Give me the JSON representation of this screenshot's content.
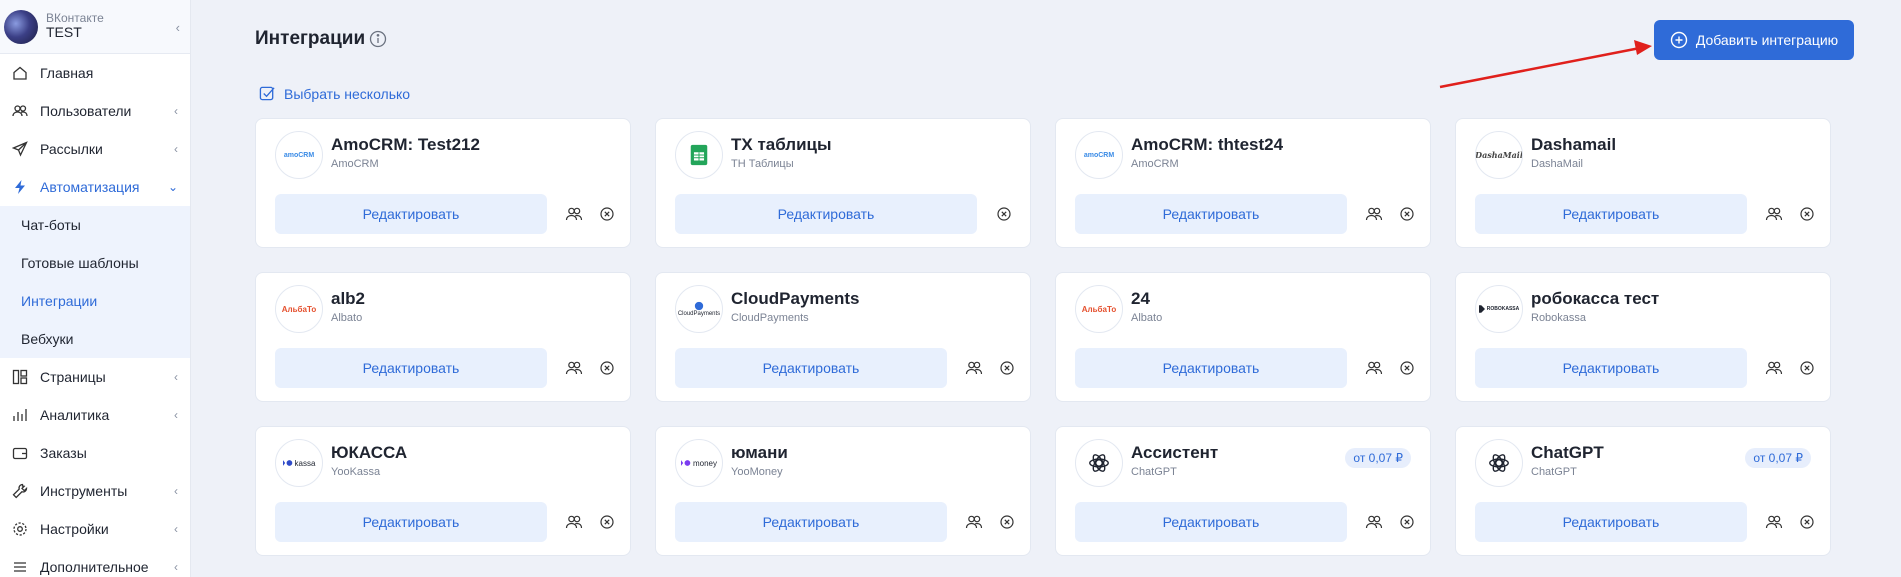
{
  "account": {
    "sub": "ВКонтакте",
    "name": "TEST"
  },
  "nav": {
    "home": "Главная",
    "users": "Пользователи",
    "mailings": "Рассылки",
    "automation": "Автоматизация",
    "sub": {
      "chatbots": "Чат-боты",
      "templates": "Готовые шаблоны",
      "integrations": "Интеграции",
      "webhooks": "Вебхуки"
    },
    "pages": "Страницы",
    "analytics": "Аналитика",
    "orders": "Заказы",
    "tools": "Инструменты",
    "settings": "Настройки",
    "more": "Дополнительное"
  },
  "header": {
    "title": "Интеграции",
    "select_many": "Выбрать несколько",
    "add_button": "Добавить интеграцию"
  },
  "colors": {
    "accent": "#2f6bd8",
    "arrow": "#e0201c",
    "button_bg": "#e8f0fd"
  },
  "cards": [
    {
      "title": "AmoCRM: Test212",
      "sub": "AmoCRM",
      "edit": "Редактировать",
      "logo": "amocrm-logo",
      "logo_text": "amoCRM"
    },
    {
      "title": "TX таблицы",
      "sub": "TH Таблицы",
      "edit": "Редактировать",
      "logo": "google-sheets-logo",
      "logo_text": ""
    },
    {
      "title": "AmoCRM: thtest24",
      "sub": "AmoCRM",
      "edit": "Редактировать",
      "logo": "amocrm-logo",
      "logo_text": "amoCRM"
    },
    {
      "title": "Dashamail",
      "sub": "DashaMail",
      "edit": "Редактировать",
      "logo": "dashamail-logo",
      "logo_text": "DashaMail"
    },
    {
      "title": "alb2",
      "sub": "Albato",
      "edit": "Редактировать",
      "logo": "albato-logo",
      "logo_text": "АльбаТо"
    },
    {
      "title": "CloudPayments",
      "sub": "CloudPayments",
      "edit": "Редактировать",
      "logo": "cloudpayments-logo",
      "logo_text": "CloudPayments"
    },
    {
      "title": "24",
      "sub": "Albato",
      "edit": "Редактировать",
      "logo": "albato-logo",
      "logo_text": "АльбаТо"
    },
    {
      "title": "робокасса тест",
      "sub": "Robokassa",
      "edit": "Редактировать",
      "logo": "robokassa-logo",
      "logo_text": "ROBOKASSA"
    },
    {
      "title": "ЮКАССА",
      "sub": "YooKassa",
      "edit": "Редактировать",
      "logo": "yookassa-logo",
      "logo_text": "kassa"
    },
    {
      "title": "юмани",
      "sub": "YooMoney",
      "edit": "Редактировать",
      "logo": "yoomoney-logo",
      "logo_text": "money"
    },
    {
      "title": "Ассистент",
      "sub": "ChatGPT",
      "edit": "Редактировать",
      "logo": "openai-logo",
      "logo_text": "",
      "price": "от 0,07 ₽"
    },
    {
      "title": "ChatGPT",
      "sub": "ChatGPT",
      "edit": "Редактировать",
      "logo": "openai-logo",
      "logo_text": "",
      "price": "от 0,07 ₽"
    }
  ]
}
